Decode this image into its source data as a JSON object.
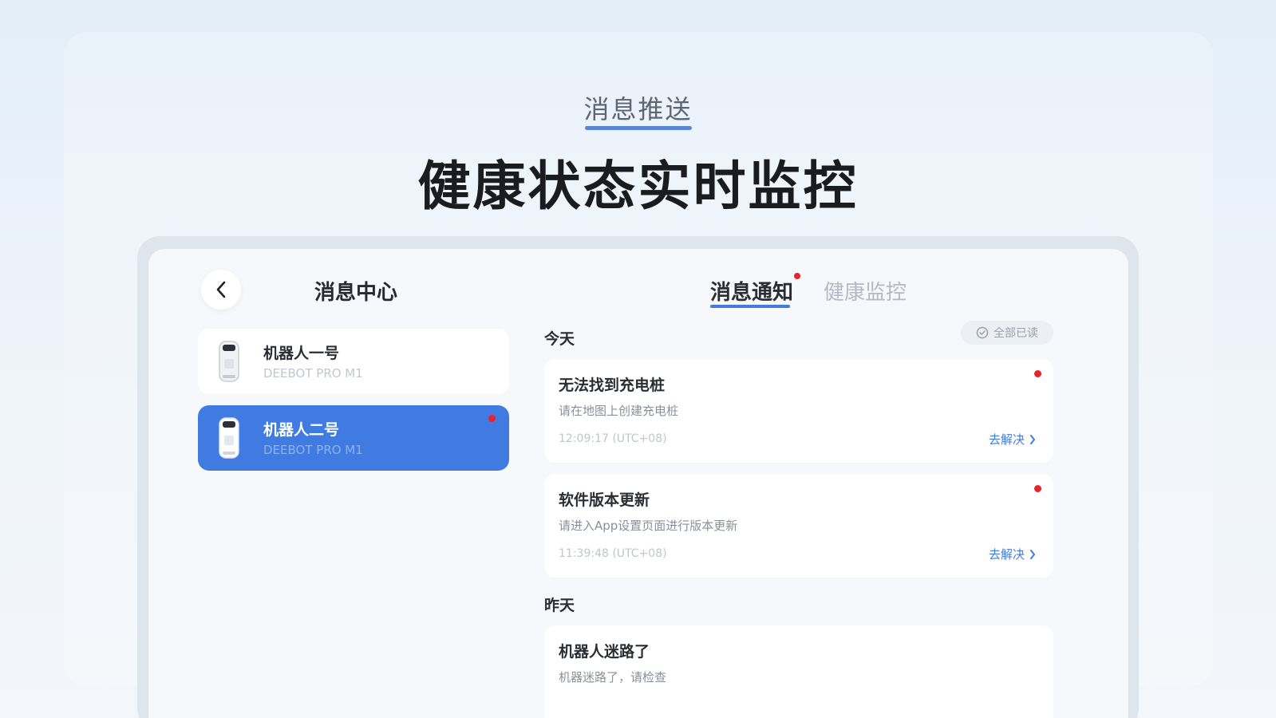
{
  "hero": {
    "kicker": "消息推送",
    "headline": "健康状态实时监控"
  },
  "colors": {
    "accent": "#3f7be0",
    "unread_dot": "#e8232b"
  },
  "left_panel": {
    "title": "消息中心",
    "back_icon": "chevron-left-icon",
    "robots": [
      {
        "name": "机器人一号",
        "model": "DEEBOT PRO M1",
        "selected": false,
        "unread": false
      },
      {
        "name": "机器人二号",
        "model": "DEEBOT PRO M1",
        "selected": true,
        "unread": true
      }
    ]
  },
  "right_panel": {
    "tabs": [
      {
        "label": "消息通知",
        "active": true,
        "unread": true
      },
      {
        "label": "健康监控",
        "active": false,
        "unread": false
      }
    ],
    "mark_all_read": "全部已读",
    "sections": [
      {
        "label": "今天",
        "messages": [
          {
            "title": "无法找到充电桩",
            "body": "请在地图上创建充电桩",
            "time": "12:09:17 (UTC+08)",
            "action": "去解决",
            "unread": true
          },
          {
            "title": "软件版本更新",
            "body": "请进入App设置页面进行版本更新",
            "time": "11:39:48 (UTC+08)",
            "action": "去解决",
            "unread": true
          }
        ]
      },
      {
        "label": "昨天",
        "messages": [
          {
            "title": "机器人迷路了",
            "body": "机器迷路了，请检查"
          }
        ]
      }
    ]
  }
}
